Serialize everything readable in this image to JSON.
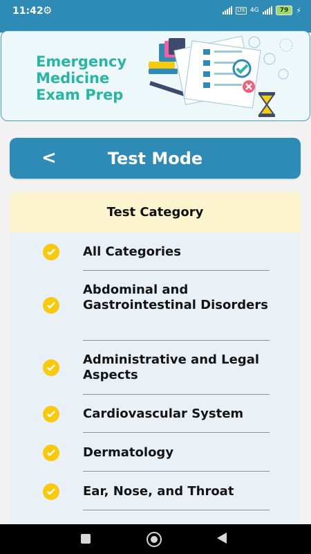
{
  "status_bar": {
    "time": "11:42",
    "settings_icon": "gear-icon",
    "network_label": "4G",
    "lte_label": "LTE",
    "battery": "79"
  },
  "banner": {
    "title_lines": [
      "Emergency",
      "Medicine",
      "Exam Prep"
    ]
  },
  "header": {
    "back_icon": "chevron-left-icon",
    "back_glyph": "<",
    "title": "Test Mode"
  },
  "category_panel": {
    "heading": "Test Category",
    "items": [
      {
        "label": "All Categories",
        "checked": true
      },
      {
        "label": "Abdominal and Gastrointestinal Disorders",
        "checked": true
      },
      {
        "label": "Administrative and Legal Aspects",
        "checked": true
      },
      {
        "label": "Cardiovascular System",
        "checked": true
      },
      {
        "label": "Dermatology",
        "checked": true
      },
      {
        "label": "Ear, Nose, and Throat",
        "checked": true
      }
    ]
  },
  "colors": {
    "primary": "#2e8bb6",
    "accent_teal": "#28b6a4",
    "check_yellow": "#f8ca0e",
    "category_header_bg": "#fcf3cf",
    "panel_bg": "#e9f1f7"
  }
}
